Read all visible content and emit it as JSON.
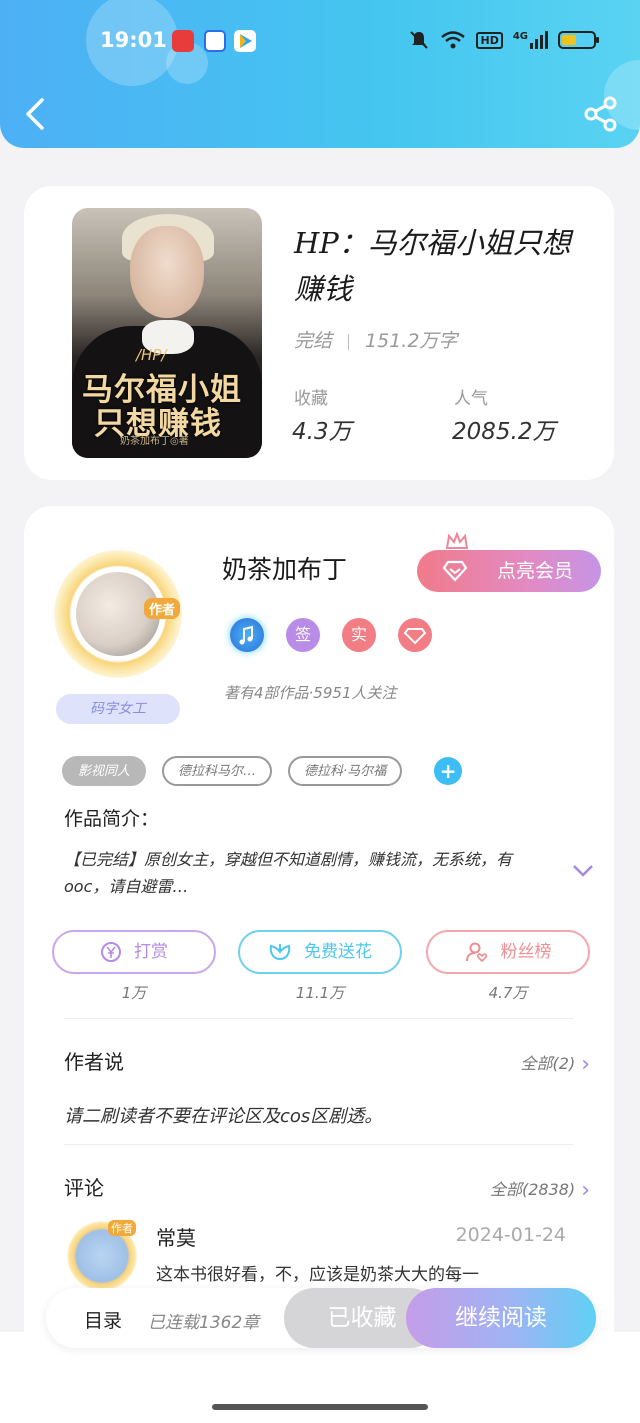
{
  "status_bar": {
    "time": "19:01",
    "network": "HD",
    "cell": "4G"
  },
  "book": {
    "title": "HP：马尔福小姐只想赚钱",
    "status": "完结",
    "word_count": "151.2万字",
    "favorites_label": "收藏",
    "favorites_value": "4.3万",
    "popularity_label": "人气",
    "popularity_value": "2085.2万",
    "cover": {
      "tag": "/HP/",
      "title_line1": "马尔福小姐",
      "title_line2": "只想赚钱",
      "author": "奶茶加布丁◎著"
    }
  },
  "author": {
    "role_tag": "作者",
    "name": "奶茶加布丁",
    "badge_title": "码字女工",
    "vip_button": "点亮会员",
    "badges": [
      "签",
      "实"
    ],
    "meta": "著有4部作品·5951人关注"
  },
  "tags": [
    "影视同人",
    "德拉科马尔…",
    "德拉科·马尔福"
  ],
  "intro": {
    "label": "作品简介：",
    "text": "【已完结】原创女主，穿越但不知道剧情，赚钱流，无系统，有ooc，请自避雷…"
  },
  "actions": [
    {
      "label": "打赏",
      "value": "1万",
      "color": "#b58be6"
    },
    {
      "label": "免费送花",
      "value": "11.1万",
      "color": "#4cc7ee"
    },
    {
      "label": "粉丝榜",
      "value": "4.7万",
      "color": "#f08d93"
    }
  ],
  "author_says": {
    "title": "作者说",
    "more": "全部(2)",
    "text": "请二刷读者不要在评论区及cos区剧透。"
  },
  "comments": {
    "title": "评论",
    "more": "全部(2838)",
    "items": [
      {
        "user": "常莫",
        "role_tag": "作者",
        "date": "2024-01-24",
        "text": "这本书很好看，不，应该是奶茶大大的每一"
      }
    ]
  },
  "bottom_bar": {
    "toc": "目录",
    "serial": "已连载1362章",
    "collected": "已收藏",
    "read": "继续阅读"
  }
}
